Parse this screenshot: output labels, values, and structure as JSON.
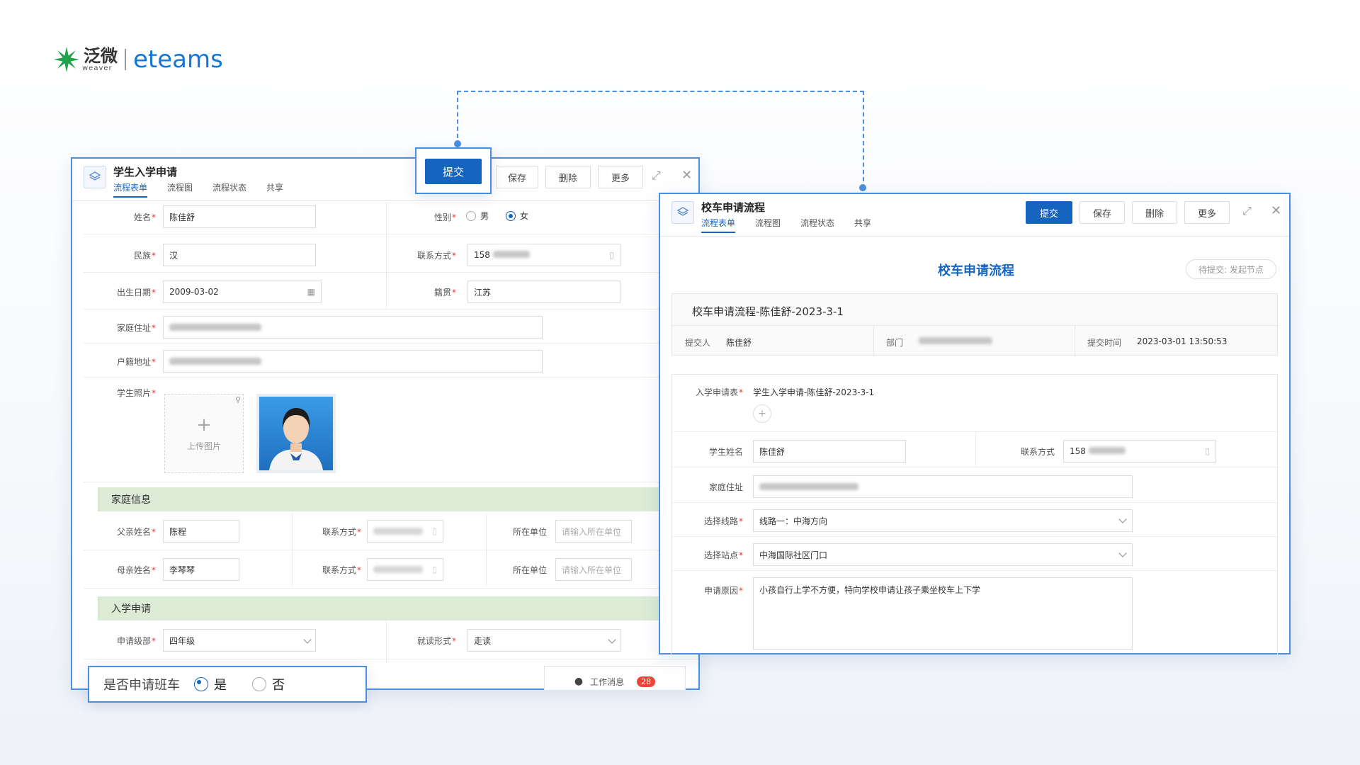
{
  "logo": {
    "cn": "泛微",
    "en": "weaver",
    "product": "eteams"
  },
  "left": {
    "title": "学生入学申请",
    "tabs": [
      "流程表单",
      "流程图",
      "流程状态",
      "共享"
    ],
    "buttons": {
      "submit": "提交",
      "save": "保存",
      "delete": "删除",
      "more": "更多"
    },
    "fields": {
      "name_label": "姓名",
      "name": "陈佳舒",
      "gender_label": "性别",
      "gender_male": "男",
      "gender_female": "女",
      "ethnic_label": "民族",
      "ethnic": "汉",
      "contact_label": "联系方式",
      "contact": "158",
      "birth_label": "出生日期",
      "birth": "2009-03-02",
      "native_label": "籍贯",
      "native": "江苏",
      "home_label": "家庭住址",
      "hukou_label": "户籍地址",
      "photo_label": "学生照片",
      "upload": "上传图片"
    },
    "family": {
      "title": "家庭信息",
      "father_label": "父亲姓名",
      "father": "陈程",
      "mother_label": "母亲姓名",
      "mother": "李琴琴",
      "contact_label": "联系方式",
      "work_label": "所在单位",
      "work_placeholder": "请输入所在单位"
    },
    "enroll": {
      "title": "入学申请",
      "grade_label": "申请级部",
      "grade": "四年级",
      "mode_label": "就读形式",
      "mode": "走读"
    },
    "messages": {
      "label": "工作消息",
      "count": "28"
    },
    "bus_callout": {
      "label": "是否申请班车",
      "yes": "是",
      "no": "否"
    }
  },
  "right": {
    "title": "校车申请流程",
    "tabs": [
      "流程表单",
      "流程图",
      "流程状态",
      "共享"
    ],
    "buttons": {
      "submit": "提交",
      "save": "保存",
      "delete": "删除",
      "more": "更多"
    },
    "form_title": "校车申请流程",
    "status_badge": "待提交: 发起节点",
    "request_title": "校车申请流程-陈佳舒-2023-3-1",
    "meta": {
      "submitter_label": "提交人",
      "submitter": "陈佳舒",
      "dept_label": "部门",
      "time_label": "提交时间",
      "time": "2023-03-01 13:50:53"
    },
    "fields": {
      "enroll_form_label": "入学申请表",
      "enroll_form": "学生入学申请-陈佳舒-2023-3-1",
      "student_label": "学生姓名",
      "student": "陈佳舒",
      "contact_label": "联系方式",
      "contact": "158",
      "address_label": "家庭住址",
      "route_label": "选择线路",
      "route": "线路一：中海方向",
      "stop_label": "选择站点",
      "stop": "中海国际社区门口",
      "reason_label": "申请原因",
      "reason": "小孩自行上学不方便，特向学校申请让孩子乘坐校车上下学"
    }
  },
  "colors": {
    "accent": "#1565c0",
    "callout_border": "#4a8fe0",
    "section_bg": "#dcebd6",
    "required": "#e53935",
    "badge": "#f44336"
  }
}
